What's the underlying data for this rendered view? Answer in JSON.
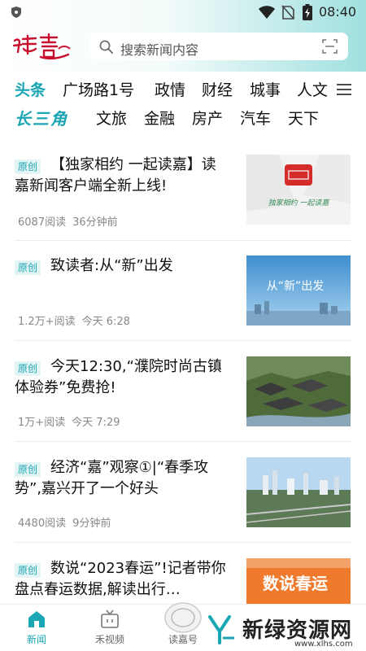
{
  "status_bar": {
    "time": "08:40"
  },
  "header": {
    "logo_text": "读嘉",
    "search_placeholder": "搜索新闻内容"
  },
  "nav_primary": [
    "头条",
    "广场路1号",
    "政情",
    "财经",
    "城事",
    "人文"
  ],
  "nav_secondary": {
    "brand": "长三角",
    "tabs": [
      "文旅",
      "金融",
      "房产",
      "汽车",
      "天下"
    ]
  },
  "articles": [
    {
      "tag": "原创",
      "title": "【独家相约 一起读嘉】读嘉新闻客户端全新上线!",
      "reads": "6087阅读",
      "time": "36分钟前",
      "thumb_text": "独家相约 一起读嘉"
    },
    {
      "tag": "原创",
      "title": "致读者:从“新”出发",
      "reads": "1.2万+阅读",
      "time": "今天 6:28",
      "thumb_text": "从“新”出发"
    },
    {
      "tag": "原创",
      "title": "今天12:30,“濮院时尚古镇体验券”免费抢!",
      "reads": "1万+阅读",
      "time": "今天 7:29"
    },
    {
      "tag": "原创",
      "title": "经济“嘉”观察①|“春季攻势”,嘉兴开了一个好头",
      "reads": "4480阅读",
      "time": "9分钟前"
    },
    {
      "tag": "原创",
      "title": "数说“2023春运”!记者带你盘点春运数据,解读出行…",
      "thumb_text": "数说春运"
    }
  ],
  "tabbar": [
    "新闻",
    "禾视频",
    "读嘉号",
    "",
    ""
  ],
  "watermark": {
    "title": "新绿资源网",
    "url": "www.xlhs.com"
  },
  "colors": {
    "accent": "#1aa6b2",
    "header_gradient_end": "#9fe0df"
  }
}
